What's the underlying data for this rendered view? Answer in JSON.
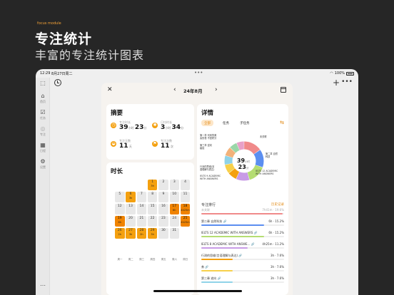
{
  "promo": {
    "badge": "focus module",
    "title": "专注统计",
    "subtitle": "丰富的专注统计图表"
  },
  "statusbar": {
    "time": "12:29",
    "date": "8月27日周二",
    "dots": "•••",
    "battery": "100%"
  },
  "sidebar": {
    "items": [
      {
        "label": "",
        "icon": "sidebar-toggle-icon"
      },
      {
        "label": "首页",
        "icon": "home-icon"
      },
      {
        "label": "任务",
        "icon": "task-icon"
      },
      {
        "label": "专注",
        "icon": "focus-icon"
      },
      {
        "label": "日程",
        "icon": "calendar-icon"
      },
      {
        "label": "设置",
        "icon": "settings-icon"
      },
      {
        "label": "",
        "icon": "more-icon"
      }
    ]
  },
  "toolbar": {
    "plus": "+",
    "more": "•••"
  },
  "modal": {
    "close": "✕",
    "prev": "‹",
    "month": "24年8月",
    "next": "›"
  },
  "summary": {
    "title": "摘要",
    "stats": [
      {
        "label": "专注时长",
        "h": "39",
        "hu": "小时",
        "m": "23",
        "mu": "分",
        "color": "#f4a00f",
        "icon": "clock-icon"
      },
      {
        "label": "日均时长",
        "h": "3",
        "hu": "小时",
        "m": "34",
        "mu": "分",
        "color": "#f4a00f",
        "icon": "sun-icon"
      },
      {
        "label": "专注天数",
        "h": "11",
        "hu": "天",
        "m": "",
        "mu": "",
        "color": "#f4a00f",
        "icon": "sunrise-icon"
      },
      {
        "label": "专注次数",
        "h": "11",
        "hu": "次",
        "m": "",
        "mu": "",
        "color": "#f4a00f",
        "icon": "flag-icon"
      }
    ]
  },
  "duration": {
    "title": "时长",
    "weekdays": [
      "周一",
      "周二",
      "周三",
      "周四",
      "周五",
      "周六",
      "周日"
    ],
    "days": [
      {
        "d": "1",
        "t": "3h",
        "c": "on"
      },
      {
        "d": "2",
        "t": "",
        "c": ""
      },
      {
        "d": "3",
        "t": "",
        "c": ""
      },
      {
        "d": "4",
        "t": "",
        "c": ""
      },
      {
        "d": "5",
        "t": "",
        "c": ""
      },
      {
        "d": "6",
        "t": "3h",
        "c": "on"
      },
      {
        "d": "7",
        "t": "",
        "c": ""
      },
      {
        "d": "8",
        "t": "",
        "c": ""
      },
      {
        "d": "9",
        "t": "",
        "c": ""
      },
      {
        "d": "10",
        "t": "",
        "c": ""
      },
      {
        "d": "11",
        "t": "",
        "c": ""
      },
      {
        "d": "12",
        "t": "",
        "c": ""
      },
      {
        "d": "13",
        "t": "",
        "c": ""
      },
      {
        "d": "14",
        "t": "",
        "c": ""
      },
      {
        "d": "15",
        "t": "",
        "c": ""
      },
      {
        "d": "16",
        "t": "",
        "c": ""
      },
      {
        "d": "17",
        "t": "6h",
        "c": "hot"
      },
      {
        "d": "18",
        "t": "4h25m",
        "c": "hot"
      },
      {
        "d": "19",
        "t": "6h",
        "c": "hot"
      },
      {
        "d": "20",
        "t": "",
        "c": ""
      },
      {
        "d": "21",
        "t": "",
        "c": ""
      },
      {
        "d": "22",
        "t": "",
        "c": ""
      },
      {
        "d": "23",
        "t": "",
        "c": ""
      },
      {
        "d": "24",
        "t": "",
        "c": ""
      },
      {
        "d": "25",
        "t": "4h25m",
        "c": "hot"
      },
      {
        "d": "26",
        "t": "2h",
        "c": "on"
      },
      {
        "d": "27",
        "t": "3h",
        "c": "on"
      },
      {
        "d": "28",
        "t": "2h",
        "c": "on"
      },
      {
        "d": "29",
        "t": "3h",
        "c": "on"
      },
      {
        "d": "30",
        "t": "",
        "c": ""
      },
      {
        "d": "31",
        "t": "",
        "c": ""
      }
    ]
  },
  "details": {
    "title": "详情",
    "tabs": [
      "全部",
      "任务",
      "子任务"
    ],
    "filter_icon": "⇆",
    "center_h": "39",
    "center_m": "23",
    "h_unit": "小时",
    "m_unit": "分",
    "labels_left": [
      "第一章 代码的美",
      "素的表",
      "不是积分",
      "第三章 逆向",
      "级经",
      "行测的思维(言",
      "语理解与表达)",
      "IELTS 9 ACADEMIC",
      "WITH ANSWERS"
    ],
    "labels_right": [
      "未关联",
      "第二章 自然",
      "科技",
      "IELTS 12 ACADEMIC",
      "WITH ANSWERS"
    ],
    "slices": [
      {
        "name": "未关联",
        "value": 15.2,
        "color": "#f08a8a"
      },
      {
        "name": "第二章 自然科技",
        "value": 15.2,
        "color": "#5b8ef0"
      },
      {
        "name": "IELTS 12 ACADEMIC WITH ANSWERS",
        "value": 15.2,
        "color": "#b5dd72"
      },
      {
        "name": "IELTS 8 ACADEMIC WITH ANSWERS",
        "value": 11.2,
        "color": "#c89be6"
      },
      {
        "name": "行测的思维",
        "value": 7.6,
        "color": "#f4a00f"
      },
      {
        "name": "券",
        "value": 7.6,
        "color": "#f7d04a"
      },
      {
        "name": "第三章 逆向",
        "value": 7.6,
        "color": "#8fd3e8"
      },
      {
        "name": "不是积分",
        "value": 7.6,
        "color": "#f2b27a"
      },
      {
        "name": "素的表",
        "value": 6.5,
        "color": "#9ad6a8"
      },
      {
        "name": "第一章 代码的美",
        "value": 6.3,
        "color": "#e8a0c8"
      }
    ],
    "rank_title": "专注排行",
    "rank_history": "历史记录",
    "ranking": [
      {
        "name": "未关联",
        "value": "7h41m · 19.6%",
        "pct": 19.6,
        "color": "#f08a8a"
      },
      {
        "name": "第二章 自然科技 🔗",
        "value": "6h · 15.2%",
        "pct": 15.2,
        "color": "#5b8ef0"
      },
      {
        "name": "IELTS 12 ACADEMIC WITH ANSWERS 🔗",
        "value": "6h · 15.2%",
        "pct": 15.2,
        "color": "#b5dd72"
      },
      {
        "name": "IELTS 8 ACADEMIC WITH ANSWE... 🔗",
        "value": "4h25m · 11.2%",
        "pct": 11.2,
        "color": "#c89be6"
      },
      {
        "name": "行测的思维(言语理解与表达) 🔗",
        "value": "3h · 7.6%",
        "pct": 7.6,
        "color": "#f4a00f"
      },
      {
        "name": "券 🔗",
        "value": "3h · 7.6%",
        "pct": 7.6,
        "color": "#f7d04a"
      },
      {
        "name": "第三章 逆向 🔗",
        "value": "3h · 7.6%",
        "pct": 7.6,
        "color": "#8fd3e8"
      }
    ]
  }
}
